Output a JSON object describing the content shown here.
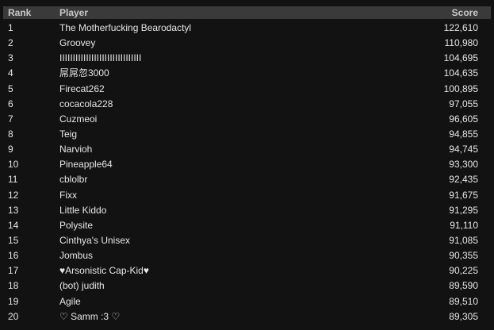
{
  "leaderboard": {
    "headers": {
      "rank": "Rank",
      "player": "Player",
      "score": "Score"
    },
    "rows": [
      {
        "rank": "1",
        "player": "The Motherfucking Bearodactyl",
        "score": "122,610"
      },
      {
        "rank": "2",
        "player": "Groovey",
        "score": "110,980"
      },
      {
        "rank": "3",
        "player": "IIIIIIIIIIIIIIIIIIIIIIIIIIIIIII",
        "score": "104,695"
      },
      {
        "rank": "4",
        "player": "屌屌忽3000",
        "score": "104,635"
      },
      {
        "rank": "5",
        "player": "Firecat262",
        "score": "100,895"
      },
      {
        "rank": "6",
        "player": "cocacola228",
        "score": "97,055"
      },
      {
        "rank": "7",
        "player": "Cuzmeoi",
        "score": "96,605"
      },
      {
        "rank": "8",
        "player": "Teig",
        "score": "94,855"
      },
      {
        "rank": "9",
        "player": "Narvioh",
        "score": "94,745"
      },
      {
        "rank": "10",
        "player": "Pineapple64",
        "score": "93,300"
      },
      {
        "rank": "11",
        "player": "cblolbr",
        "score": "92,435"
      },
      {
        "rank": "12",
        "player": "Fixx",
        "score": "91,675"
      },
      {
        "rank": "13",
        "player": "Little Kiddo",
        "score": "91,295"
      },
      {
        "rank": "14",
        "player": "Polysite",
        "score": "91,110"
      },
      {
        "rank": "15",
        "player": "Cinthya's Unisex",
        "score": "91,085"
      },
      {
        "rank": "16",
        "player": "Jombus",
        "score": "90,355"
      },
      {
        "rank": "17",
        "player": "♥Arsonistic Cap-Kid♥",
        "score": "90,225"
      },
      {
        "rank": "18",
        "player": "(bot) judith",
        "score": "89,590"
      },
      {
        "rank": "19",
        "player": "Agile",
        "score": "89,510"
      },
      {
        "rank": "20",
        "player": "♡ Samm :3 ♡",
        "score": "89,305"
      }
    ]
  }
}
